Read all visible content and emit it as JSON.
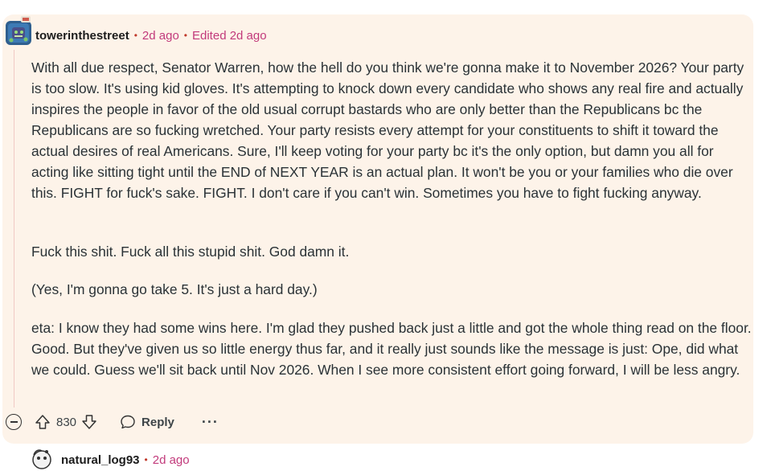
{
  "comment": {
    "author": "towerinthestreet",
    "separator": "•",
    "time": "2d ago",
    "edited": "Edited 2d ago",
    "paragraphs": [
      "With all due respect, Senator Warren, how the hell do you think we're gonna make it to November 2026? Your party is too slow. It's using kid gloves. It's attempting to knock down every candidate who shows any real fire and actually inspires the people in favor of the old usual corrupt bastards who are only better than the Republicans bc the Republicans are so fucking wretched. Your party resists every attempt for your constituents to shift it toward the actual desires of real Americans. Sure, I'll keep voting for your party bc it's the only option, but damn you all for acting like sitting tight until the END of NEXT YEAR is an actual plan. It won't be you or your families who die over this. FIGHT for fuck's sake. FIGHT. I don't care if you can't win. Sometimes you have to fight fucking anyway.",
      "Fuck this shit. Fuck all this stupid shit. God damn it.",
      "(Yes, I'm gonna go take 5. It's just a hard day.)",
      "eta: I know they had some wins here. I'm glad they pushed back just a little and got the whole thing read on the floor. Good. But they've given us so little energy thus far, and it really just sounds like the message is just: Ope, did what we could. Guess we'll sit back until Nov 2026. When I see more consistent effort going forward, I will be less angry."
    ],
    "votes": "830",
    "reply_label": "Reply",
    "more_label": "···",
    "icons": {
      "collapse": "collapse-icon",
      "upvote": "upvote-icon",
      "downvote": "downvote-icon",
      "reply": "comment-bubble-icon",
      "more": "more-options-icon"
    }
  },
  "next_comment": {
    "author": "natural_log93",
    "separator": "•",
    "time": "2d ago"
  },
  "colors": {
    "card_background": "#fdf3e9",
    "meta_pink": "#c23a7b",
    "thread_line": "#f0c9c4"
  }
}
